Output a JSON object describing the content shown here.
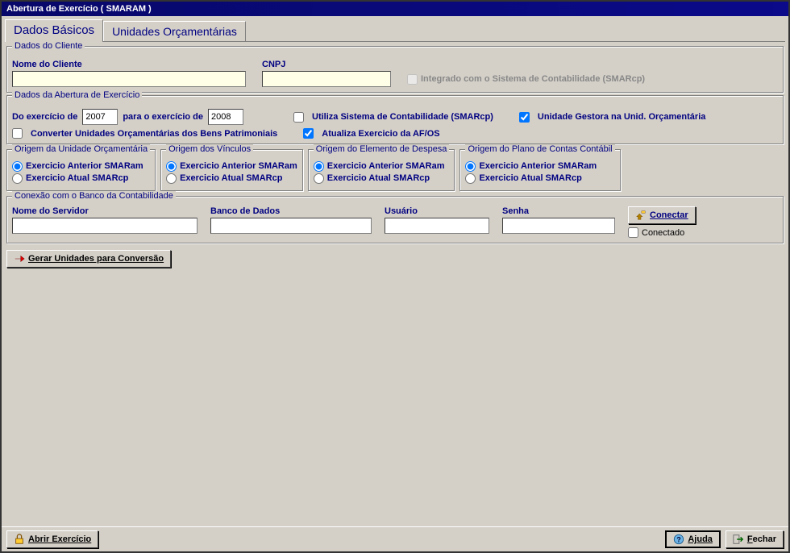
{
  "window": {
    "title": "Abertura de Exercício ( SMARAM )"
  },
  "tabs": [
    {
      "label": "Dados Básicos",
      "active": true
    },
    {
      "label": "Unidades Orçamentárias",
      "active": false
    }
  ],
  "cliente": {
    "group_title": "Dados do Cliente",
    "nome_label": "Nome do Cliente",
    "nome_value": "",
    "cnpj_label": "CNPJ",
    "cnpj_value": "",
    "integrado_label": "Integrado com o Sistema de Contabilidade (SMARcp)",
    "integrado_checked": false
  },
  "abertura": {
    "group_title": "Dados da Abertura de Exercício",
    "do_exercicio_label": "Do exercício de",
    "do_exercicio_value": "2007",
    "para_exercicio_label": "para o exercício de",
    "para_exercicio_value": "2008",
    "utiliza_contab_label": "Utiliza Sistema de Contabilidade (SMARcp)",
    "utiliza_contab_checked": false,
    "unidade_gestora_label": "Unidade Gestora na Unid. Orçamentária",
    "unidade_gestora_checked": true,
    "converter_unidades_label": "Converter Unidades Orçamentárias dos Bens Patrimoniais",
    "converter_unidades_checked": false,
    "atualiza_af_label": "Atualiza Exercicio da AF/OS",
    "atualiza_af_checked": true
  },
  "origem_options": {
    "anterior": "Exercicio Anterior SMARam",
    "atual": "Exercicio Atual SMARcp"
  },
  "origens": [
    {
      "title": "Origem da Unidade Orçamentária",
      "selected": "anterior"
    },
    {
      "title": "Origem dos Vínculos",
      "selected": "anterior"
    },
    {
      "title": "Origem do Elemento de Despesa",
      "selected": "anterior"
    },
    {
      "title": "Origem do Plano de Contas Contábil",
      "selected": "anterior"
    }
  ],
  "conexao": {
    "group_title": "Conexão com o Banco da Contabilidade",
    "servidor_label": "Nome do Servidor",
    "servidor_value": "",
    "banco_label": "Banco de Dados",
    "banco_value": "",
    "usuario_label": "Usuário",
    "usuario_value": "",
    "senha_label": "Senha",
    "senha_value": "",
    "conectar_label": "Conectar",
    "conectado_label": "Conectado",
    "conectado_checked": false
  },
  "actions": {
    "gerar_unidades": "Gerar Unidades para Conversão",
    "abrir_exercicio": "Abrir Exercício",
    "ajuda": "Ajuda",
    "fechar": "Fechar"
  }
}
